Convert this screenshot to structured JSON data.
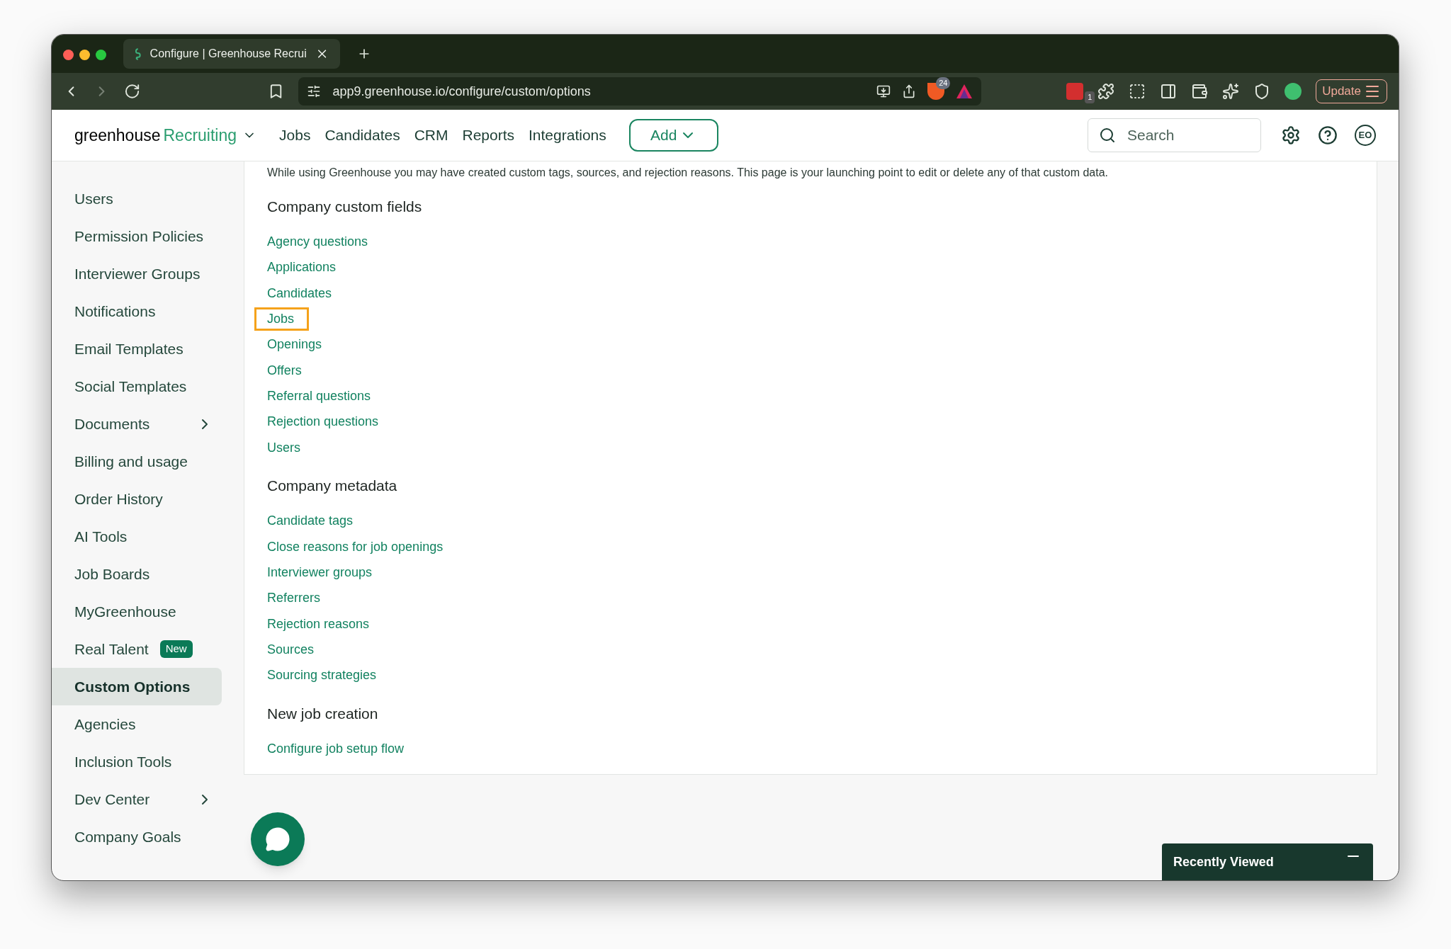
{
  "browser": {
    "tab_title": "Configure | Greenhouse Recrui",
    "url": "app9.greenhouse.io/configure/custom/options",
    "shield_count": "24",
    "extension_count": "1",
    "update_label": "Update"
  },
  "header": {
    "brand": "greenhouse",
    "product": "Recruiting",
    "nav": [
      "Jobs",
      "Candidates",
      "CRM",
      "Reports",
      "Integrations"
    ],
    "add_label": "Add",
    "search": {
      "placeholder": "Search"
    },
    "avatar": "EO"
  },
  "sidebar": {
    "items": [
      {
        "label": "Users",
        "selected": false,
        "submenu": false
      },
      {
        "label": "Permission Policies",
        "selected": false,
        "submenu": false
      },
      {
        "label": "Interviewer Groups",
        "selected": false,
        "submenu": false
      },
      {
        "label": "Notifications",
        "selected": false,
        "submenu": false
      },
      {
        "label": "Email Templates",
        "selected": false,
        "submenu": false
      },
      {
        "label": "Social Templates",
        "selected": false,
        "submenu": false
      },
      {
        "label": "Documents",
        "selected": false,
        "submenu": true
      },
      {
        "label": "Billing and usage",
        "selected": false,
        "submenu": false
      },
      {
        "label": "Order History",
        "selected": false,
        "submenu": false
      },
      {
        "label": "AI Tools",
        "selected": false,
        "submenu": false
      },
      {
        "label": "Job Boards",
        "selected": false,
        "submenu": false
      },
      {
        "label": "MyGreenhouse",
        "selected": false,
        "submenu": false
      },
      {
        "label": "Real Talent",
        "selected": false,
        "submenu": false,
        "badge": "New"
      },
      {
        "label": "Custom Options",
        "selected": true,
        "submenu": false
      },
      {
        "label": "Agencies",
        "selected": false,
        "submenu": false
      },
      {
        "label": "Inclusion Tools",
        "selected": false,
        "submenu": false
      },
      {
        "label": "Dev Center",
        "selected": false,
        "submenu": true
      },
      {
        "label": "Company Goals",
        "selected": false,
        "submenu": false
      }
    ]
  },
  "content": {
    "intro": "While using Greenhouse you may have created custom tags, sources, and rejection reasons. This page is your launching point to edit or delete any of that custom data.",
    "sections": [
      {
        "heading": "Company custom fields",
        "links": [
          {
            "label": "Agency questions",
            "highlighted": false
          },
          {
            "label": "Applications",
            "highlighted": false
          },
          {
            "label": "Candidates",
            "highlighted": false
          },
          {
            "label": "Jobs",
            "highlighted": true
          },
          {
            "label": "Openings",
            "highlighted": false
          },
          {
            "label": "Offers",
            "highlighted": false
          },
          {
            "label": "Referral questions",
            "highlighted": false
          },
          {
            "label": "Rejection questions",
            "highlighted": false
          },
          {
            "label": "Users",
            "highlighted": false
          }
        ]
      },
      {
        "heading": "Company metadata",
        "links": [
          {
            "label": "Candidate tags",
            "highlighted": false
          },
          {
            "label": "Close reasons for job openings",
            "highlighted": false
          },
          {
            "label": "Interviewer groups",
            "highlighted": false
          },
          {
            "label": "Referrers",
            "highlighted": false
          },
          {
            "label": "Rejection reasons",
            "highlighted": false
          },
          {
            "label": "Sources",
            "highlighted": false
          },
          {
            "label": "Sourcing strategies",
            "highlighted": false
          }
        ]
      },
      {
        "heading": "New job creation",
        "links": [
          {
            "label": "Configure job setup flow",
            "highlighted": false
          }
        ]
      }
    ]
  },
  "recently_viewed": {
    "title": "Recently Viewed",
    "expanded": true
  }
}
